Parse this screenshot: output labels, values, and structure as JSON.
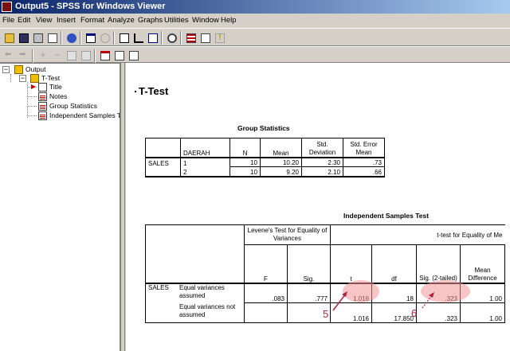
{
  "window": {
    "title": "Output5 - SPSS for Windows Viewer"
  },
  "menu": [
    "File",
    "Edit",
    "View",
    "Insert",
    "Format",
    "Analyze",
    "Graphs",
    "Utilities",
    "Window",
    "Help"
  ],
  "toolbar_icons": {
    "row1": [
      "open-icon",
      "save-icon",
      "print-icon",
      "print-preview-icon",
      "export-icon",
      "recall-dialog-icon",
      "undo-icon",
      "goto-data-icon",
      "goto-case-icon",
      "variables-icon",
      "use-sets-icon",
      "designate-window-icon",
      "run-script-icon",
      "help-icon"
    ],
    "row2": [
      "promote-icon",
      "demote-icon",
      "expand-icon",
      "collapse-icon",
      "show-icon",
      "hide-icon",
      "insert-heading-icon",
      "insert-title-icon",
      "insert-text-icon"
    ]
  },
  "outline": {
    "root": "Output",
    "group": "T-Test",
    "items": [
      "Title",
      "Notes",
      "Group Statistics",
      "Independent Samples Te"
    ]
  },
  "viewer": {
    "heading": "T-Test",
    "group_stats": {
      "title": "Group Statistics",
      "headers": {
        "grouping": "DAERAH",
        "n": "N",
        "mean": "Mean",
        "sd": "Std. Deviation",
        "se": "Std. Error Mean"
      },
      "variable": "SALES",
      "rows": [
        {
          "group": "1",
          "n": "10",
          "mean": "10.20",
          "sd": "2.30",
          "se": ".73"
        },
        {
          "group": "2",
          "n": "10",
          "mean": "9.20",
          "sd": "2.10",
          "se": ".66"
        }
      ]
    },
    "indep_test": {
      "title": "Independent Samples Test",
      "levene_header": "Levene's Test for Equality of Variances",
      "ttest_header": "t-test for Equality of Me",
      "cols": {
        "f": "F",
        "sig": "Sig.",
        "t": "t",
        "df": "df",
        "sig2": "Sig. (2-tailed)",
        "md": "Mean Difference"
      },
      "variable": "SALES",
      "rows": [
        {
          "label": "Equal variances assumed",
          "f": ".083",
          "sig": ".777",
          "t": "1.016",
          "df": "18",
          "sig2": ".323",
          "md": "1.00"
        },
        {
          "label": "Equal variances not assumed",
          "f": "",
          "sig": "",
          "t": "1.016",
          "df": "17.850",
          "sig2": ".323",
          "md": "1.00"
        }
      ]
    },
    "annotations": {
      "a5": "5",
      "a6": "6"
    }
  },
  "colors": {
    "annotation": "#b02040",
    "highlight": "#f09696"
  }
}
